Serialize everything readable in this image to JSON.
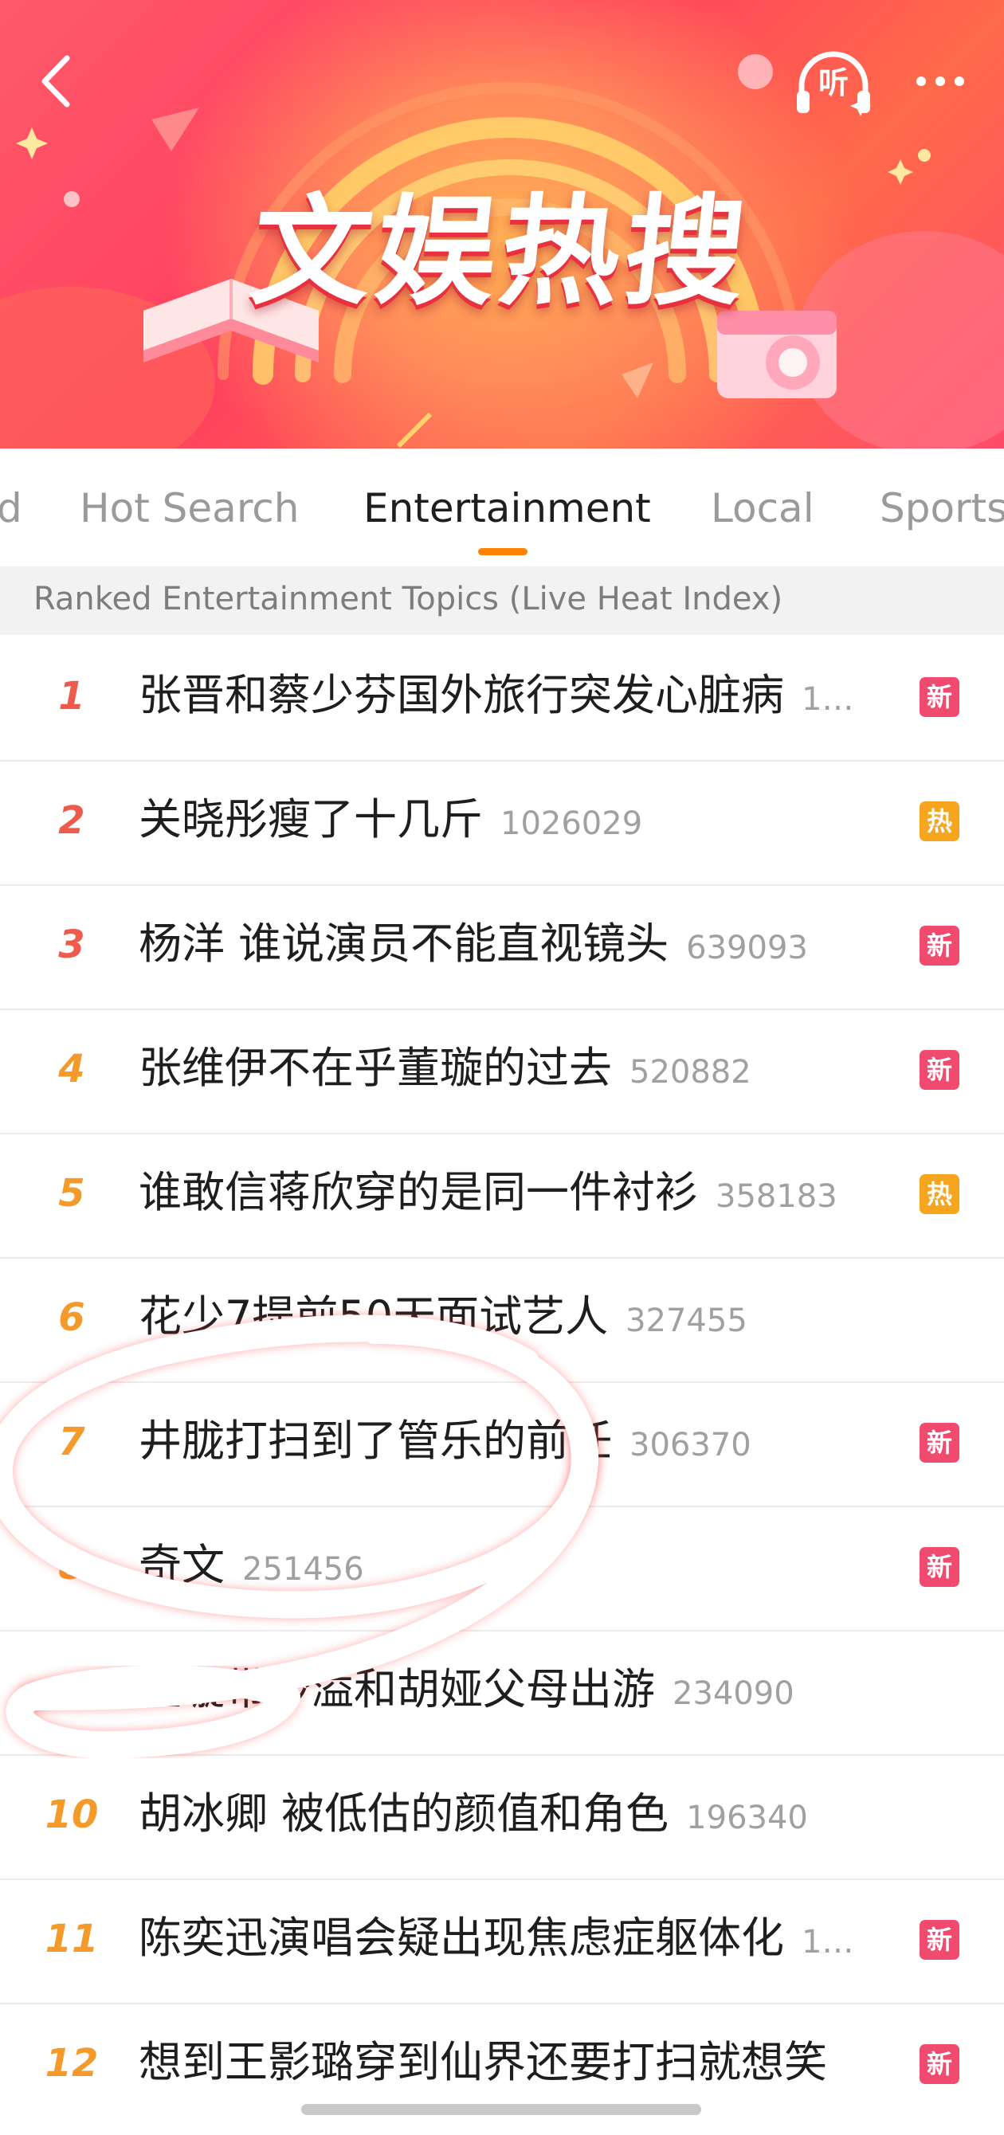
{
  "header": {
    "title": "文娱热搜",
    "listen_label": "听"
  },
  "tabs": [
    {
      "label": "d"
    },
    {
      "label": "Hot Search"
    },
    {
      "label": "Entertainment",
      "active": true
    },
    {
      "label": "Local"
    },
    {
      "label": "Sports"
    }
  ],
  "section_header": "Ranked Entertainment Topics (Live Heat Index)",
  "rows": [
    {
      "rank": "1",
      "title": "张晋和蔡少芬国外旅行突发心脏病",
      "heat": "1…",
      "badge": "新",
      "badge_type": "new"
    },
    {
      "rank": "2",
      "title": "关晓彤瘦了十几斤",
      "heat": "1026029",
      "badge": "热",
      "badge_type": "hot"
    },
    {
      "rank": "3",
      "title": "杨洋 谁说演员不能直视镜头",
      "heat": "639093",
      "badge": "新",
      "badge_type": "new"
    },
    {
      "rank": "4",
      "title": "张维伊不在乎董璇的过去",
      "heat": "520882",
      "badge": "新",
      "badge_type": "new"
    },
    {
      "rank": "5",
      "title": "谁敢信蒋欣穿的是同一件衬衫",
      "heat": "358183",
      "badge": "热",
      "badge_type": "hot"
    },
    {
      "rank": "6",
      "title": "花少7提前50天面试艺人",
      "heat": "327455",
      "badge": "",
      "badge_type": ""
    },
    {
      "rank": "7",
      "title": "井胧打扫到了管乐的前任",
      "heat": "306370",
      "badge": "新",
      "badge_type": "new"
    },
    {
      "rank": "8",
      "title": "奇文",
      "heat": "251456",
      "badge": "新",
      "badge_type": "new"
    },
    {
      "rank": "9",
      "title": "董璇带沙溢和胡娅父母出游",
      "heat": "234090",
      "badge": "",
      "badge_type": ""
    },
    {
      "rank": "10",
      "title": "胡冰卿 被低估的颜值和角色",
      "heat": "196340",
      "badge": "",
      "badge_type": ""
    },
    {
      "rank": "11",
      "title": "陈奕迅演唱会疑出现焦虑症躯体化",
      "heat": "1…",
      "badge": "新",
      "badge_type": "new"
    },
    {
      "rank": "12",
      "title": "想到王影璐穿到仙界还要打扫就想笑",
      "heat": "",
      "badge": "新",
      "badge_type": "new"
    }
  ],
  "colors": {
    "rank_top3": "#ee5a4c",
    "rank_rest": "#f39a2a",
    "badge_new": "#f04b6e",
    "badge_hot": "#f7a41f",
    "tab_indicator": "#ff8200"
  }
}
